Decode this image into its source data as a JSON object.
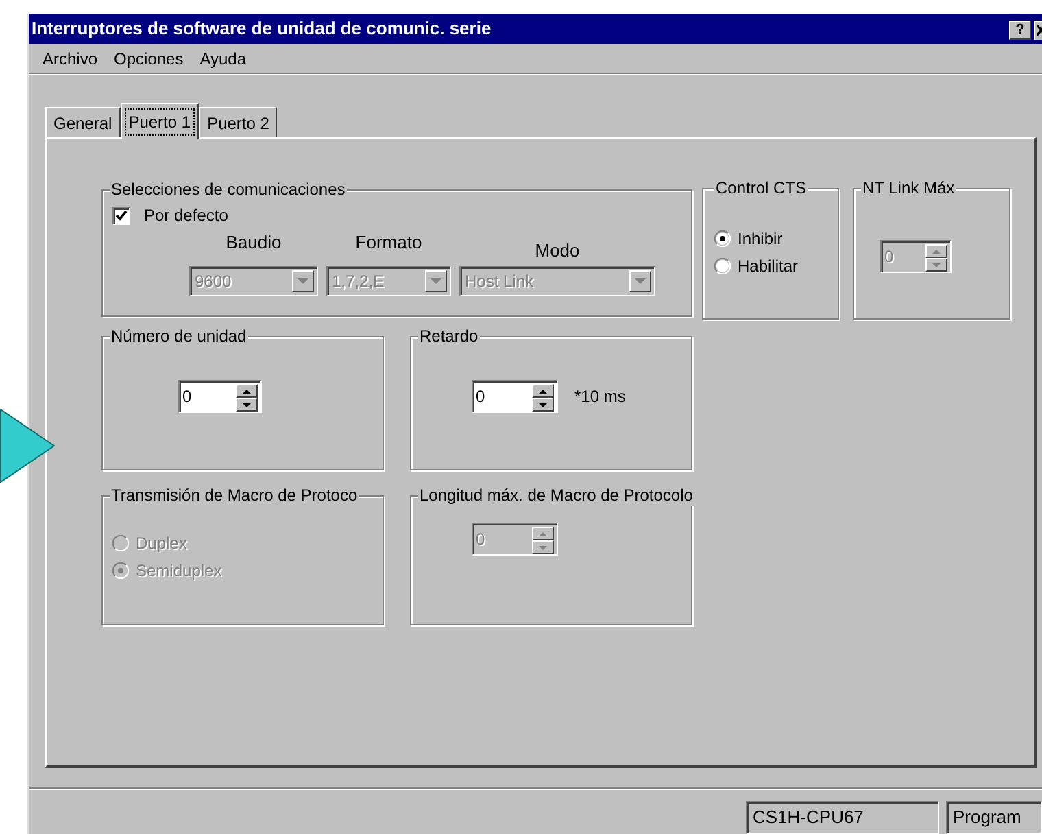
{
  "window": {
    "title": "Interruptores de software de unidad de comunic. serie"
  },
  "title_buttons": [
    {
      "kind": "help",
      "label": "?"
    },
    {
      "kind": "close"
    }
  ],
  "menu": [
    "Archivo",
    "Opciones",
    "Ayuda"
  ],
  "tabs": [
    {
      "label": "General",
      "selected": false
    },
    {
      "label": "Puerto 1",
      "selected": true
    },
    {
      "label": "Puerto 2",
      "selected": false
    }
  ],
  "communications": {
    "title": "Selecciones de comunicaciones",
    "default_checkbox": {
      "label": "Por defecto",
      "checked": true
    },
    "combos": [
      {
        "label": "Baudio",
        "value": "9600",
        "disabled": true
      },
      {
        "label": "Formato",
        "value": "1,7,2,E",
        "disabled": true
      },
      {
        "label": "Modo",
        "value": "Host Link",
        "disabled": true
      }
    ]
  },
  "control_cts": {
    "title": "Control CTS",
    "options": [
      {
        "label": "Inhibir",
        "selected": true
      },
      {
        "label": "Habilitar",
        "selected": false
      }
    ]
  },
  "nt_link_max": {
    "title": "NT Link Máx",
    "value": "0",
    "disabled": true
  },
  "unit_number": {
    "title": "Número de unidad",
    "value": "0",
    "disabled": false
  },
  "delay": {
    "title": "Retardo",
    "value": "0",
    "unit": "*10 ms",
    "disabled": false
  },
  "macro_transmission": {
    "title": "Transmisión de Macro de Protoco",
    "disabled": true,
    "options": [
      {
        "label": "Duplex",
        "selected": false
      },
      {
        "label": "Semiduplex",
        "selected": true
      }
    ]
  },
  "macro_max_length": {
    "title": "Longitud máx. de Macro de Protocolo",
    "value": "0",
    "disabled": true
  },
  "status_bar": [
    "CS1H-CPU67",
    "Program"
  ]
}
